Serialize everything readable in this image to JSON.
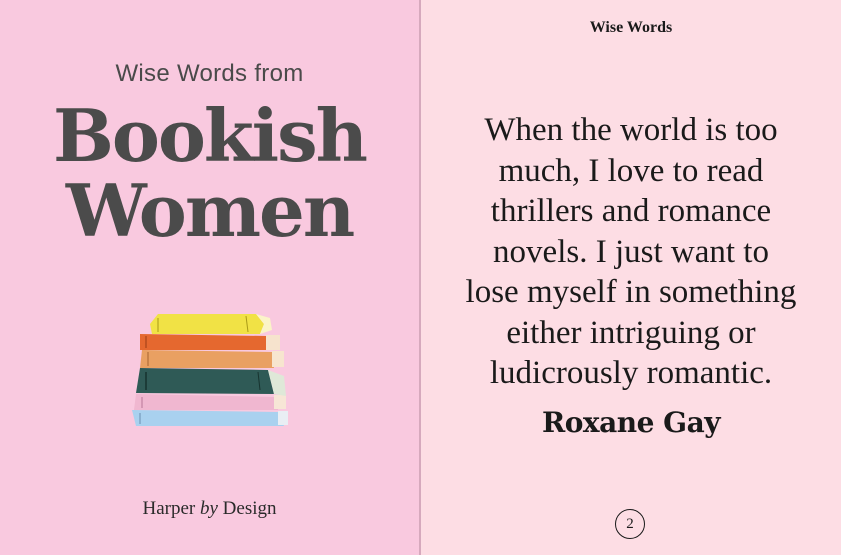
{
  "cover": {
    "subtitle": "Wise Words from",
    "title_line1": "Bookish",
    "title_line2": "Women",
    "publisher_pre": "Harper",
    "publisher_by": "by",
    "publisher_post": "Design",
    "illustration_icon": "stack-of-books-icon",
    "background": "#f9c9df",
    "title_color": "#4b4b4b"
  },
  "page": {
    "running_head": "Wise Words",
    "quote_lines": [
      "When the world is too",
      "much, I love to read",
      "thrillers and romance",
      "novels. I just want to",
      "lose myself in something",
      "either intriguing or",
      "ludicrously romantic."
    ],
    "author": "Roxane Gay",
    "page_number": "2",
    "background": "#fddde4"
  }
}
